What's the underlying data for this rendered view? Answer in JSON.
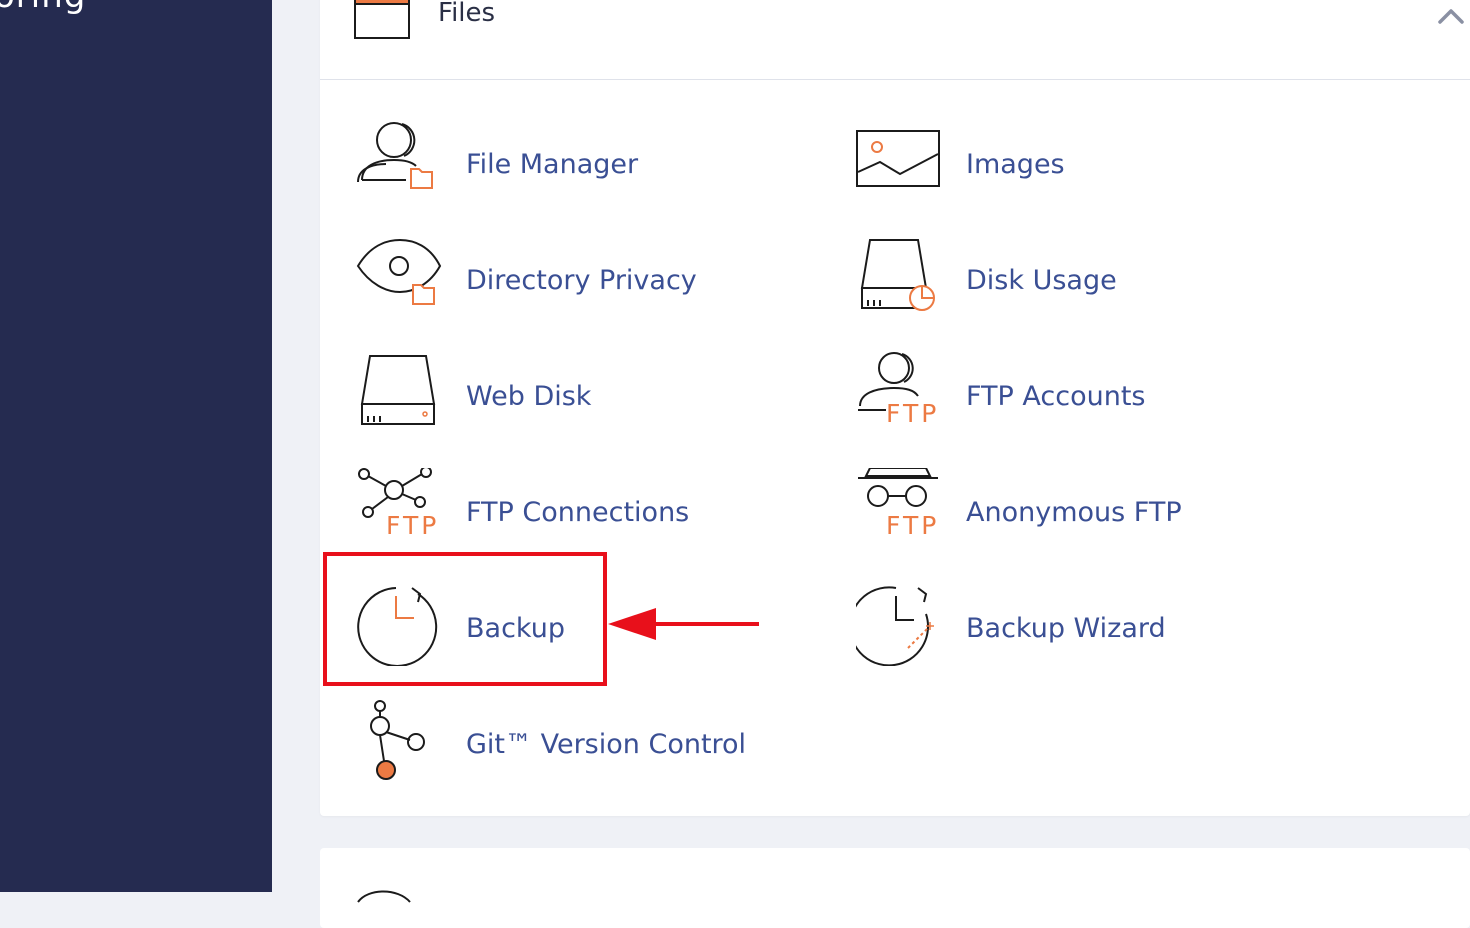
{
  "sidebar": {
    "partial_text": "oring"
  },
  "panel": {
    "title": "Files",
    "items": [
      {
        "label": "File Manager",
        "icon": "file-manager-icon"
      },
      {
        "label": "Images",
        "icon": "images-icon"
      },
      {
        "label": "Directory Privacy",
        "icon": "directory-privacy-icon"
      },
      {
        "label": "Disk Usage",
        "icon": "disk-usage-icon"
      },
      {
        "label": "Web Disk",
        "icon": "web-disk-icon"
      },
      {
        "label": "FTP Accounts",
        "icon": "ftp-accounts-icon"
      },
      {
        "label": "FTP Connections",
        "icon": "ftp-connections-icon"
      },
      {
        "label": "Anonymous FTP",
        "icon": "anonymous-ftp-icon"
      },
      {
        "label": "Backup",
        "icon": "backup-icon"
      },
      {
        "label": "Backup Wizard",
        "icon": "backup-wizard-icon"
      },
      {
        "label": "Git™ Version Control",
        "icon": "git-version-control-icon"
      }
    ],
    "ftp_text": "FTP"
  },
  "colors": {
    "sidebar": "#252b50",
    "link": "#3a4f94",
    "accent": "#ec7a43",
    "highlight": "#e8101b"
  }
}
